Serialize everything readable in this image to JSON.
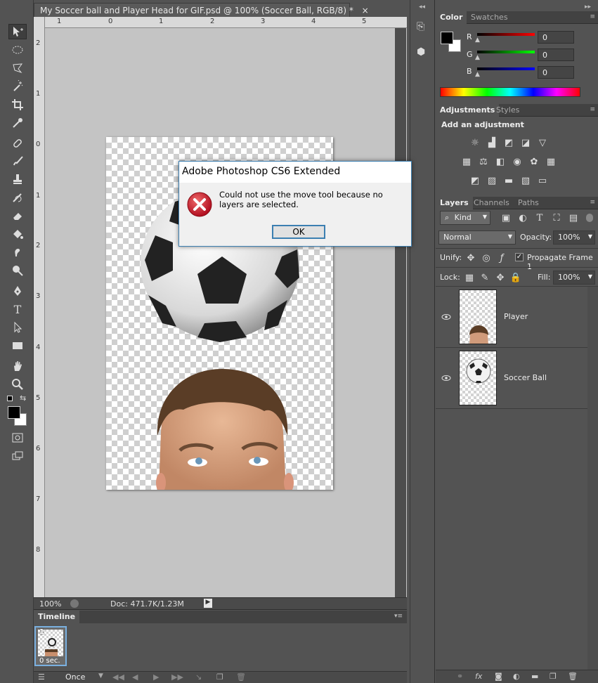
{
  "document": {
    "tab_title": "My Soccer ball and Player Head for GIF.psd @ 100% (Soccer Ball, RGB/8) *",
    "close_glyph": "×",
    "ruler_top": [
      "1",
      "0",
      "1",
      "2",
      "3",
      "4",
      "5"
    ],
    "ruler_left": [
      "2",
      "1",
      "0",
      "1",
      "2",
      "3",
      "4",
      "5",
      "6",
      "7",
      "8"
    ]
  },
  "status": {
    "zoom": "100%",
    "doc_size": "Doc: 471.7K/1.23M"
  },
  "timeline": {
    "title": "Timeline",
    "frame_number": "1",
    "frame_delay": "0 sec.",
    "loop": "Once"
  },
  "color_panel": {
    "tabs": [
      "Color",
      "Swatches"
    ],
    "channels": [
      {
        "label": "R",
        "value": "0"
      },
      {
        "label": "G",
        "value": "0"
      },
      {
        "label": "B",
        "value": "0"
      }
    ]
  },
  "adjustments_panel": {
    "tabs": [
      "Adjustments",
      "Styles"
    ],
    "heading": "Add an adjustment"
  },
  "layers_panel": {
    "tabs": [
      "Layers",
      "Channels",
      "Paths"
    ],
    "filter": "Kind",
    "blend_mode": "Normal",
    "opacity_label": "Opacity:",
    "opacity": "100%",
    "unify_label": "Unify:",
    "propagate_label": "Propagate Frame 1",
    "lock_label": "Lock:",
    "fill_label": "Fill:",
    "fill": "100%",
    "layers": [
      {
        "name": "Player"
      },
      {
        "name": "Soccer Ball"
      }
    ]
  },
  "dialog": {
    "title": "Adobe Photoshop CS6 Extended",
    "message": "Could not use the move tool because no layers are selected.",
    "ok_label": "OK"
  },
  "colors": {
    "accent": "#3c7fb1",
    "error": "#c8102e"
  }
}
